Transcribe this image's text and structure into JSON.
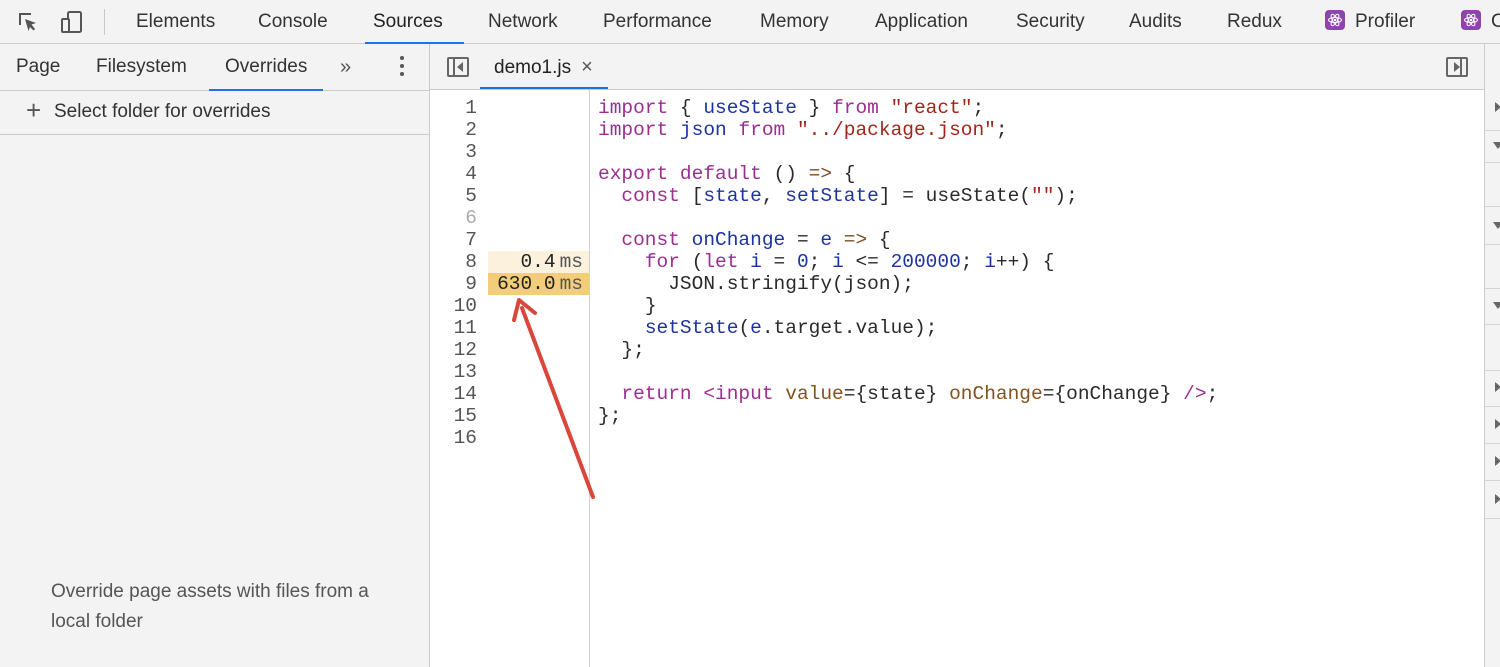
{
  "toolbar": {
    "tabs": [
      {
        "label": "Elements"
      },
      {
        "label": "Console"
      },
      {
        "label": "Sources"
      },
      {
        "label": "Network"
      },
      {
        "label": "Performance"
      },
      {
        "label": "Memory"
      },
      {
        "label": "Application"
      },
      {
        "label": "Security"
      },
      {
        "label": "Audits"
      },
      {
        "label": "Redux"
      },
      {
        "label": "Profiler"
      },
      {
        "label": "C"
      }
    ],
    "active_tab": "Sources",
    "accent_color": "#1a73e8"
  },
  "navigator": {
    "tabs": [
      {
        "label": "Page"
      },
      {
        "label": "Filesystem"
      },
      {
        "label": "Overrides"
      }
    ],
    "active_tab": "Overrides",
    "more_label": "»",
    "select_folder_plus": "+",
    "select_folder_label": "Select folder for overrides",
    "override_message": "Override page assets with files from a local folder"
  },
  "editor": {
    "file_tab": "demo1.js",
    "close_glyph": "×",
    "timing_unit": "ms",
    "timing_colors": {
      "light": "#fbf1dd",
      "strong": "#f4cd7a"
    },
    "lines": [
      {
        "n": "1",
        "time": ""
      },
      {
        "n": "2",
        "time": ""
      },
      {
        "n": "3",
        "time": ""
      },
      {
        "n": "4",
        "time": ""
      },
      {
        "n": "5",
        "time": ""
      },
      {
        "n": "6",
        "time": ""
      },
      {
        "n": "7",
        "time": ""
      },
      {
        "n": "8",
        "time": "0.4"
      },
      {
        "n": "9",
        "time": "630.0"
      },
      {
        "n": "10",
        "time": ""
      },
      {
        "n": "11",
        "time": ""
      },
      {
        "n": "12",
        "time": ""
      },
      {
        "n": "13",
        "time": ""
      },
      {
        "n": "14",
        "time": ""
      },
      {
        "n": "15",
        "time": ""
      },
      {
        "n": "16",
        "time": ""
      }
    ],
    "code": {
      "l1": {
        "k1": "import",
        "p1": " { ",
        "f1": "useState",
        "p2": " } ",
        "k2": "from",
        "p3": " ",
        "s1": "\"react\"",
        "p4": ";"
      },
      "l2": {
        "k1": "import",
        "p1": " ",
        "f1": "json",
        "p2": " ",
        "k2": "from",
        "p3": " ",
        "s1": "\"../package.json\"",
        "p4": ";"
      },
      "l4": {
        "k1": "export",
        "p1": " ",
        "k2": "default",
        "p2": " () ",
        "o1": "=>",
        "p3": " {"
      },
      "l5": {
        "i": "  ",
        "k1": "const",
        "p1": " [",
        "f1": "state",
        "p2": ", ",
        "f2": "setState",
        "p3": "] = useState(",
        "s1": "\"\"",
        "p4": ");"
      },
      "l7": {
        "i": "  ",
        "k1": "const",
        "p1": " ",
        "f1": "onChange",
        "p2": " = ",
        "f2": "e",
        "p3": " ",
        "o1": "=>",
        "p4": " {"
      },
      "l8": {
        "i": "    ",
        "k1": "for",
        "p1": " (",
        "k2": "let",
        "p2": " ",
        "f1": "i",
        "p3": " = ",
        "n1": "0",
        "p4": "; ",
        "f2": "i",
        "p5": " <= ",
        "n2": "200000",
        "p6": "; ",
        "f3": "i",
        "p7": "++) {"
      },
      "l9": {
        "i": "      ",
        "p1": "JSON.stringify(json);"
      },
      "l10": {
        "i": "    ",
        "p1": "}"
      },
      "l11": {
        "i": "    ",
        "f1": "setState",
        "p1": "(",
        "f2": "e",
        "p2": ".target.value);"
      },
      "l12": {
        "i": "  ",
        "p1": "};"
      },
      "l14": {
        "i": "  ",
        "k1": "return",
        "p1": " ",
        "t1": "<input",
        "p2": " ",
        "a1": "value",
        "p3": "={state} ",
        "a2": "onChange",
        "p4": "={onChange} ",
        "t2": "/>",
        "p5": ";"
      },
      "l15": {
        "p1": "};"
      }
    }
  },
  "annotation": {
    "arrow_color": "#d9473a"
  }
}
